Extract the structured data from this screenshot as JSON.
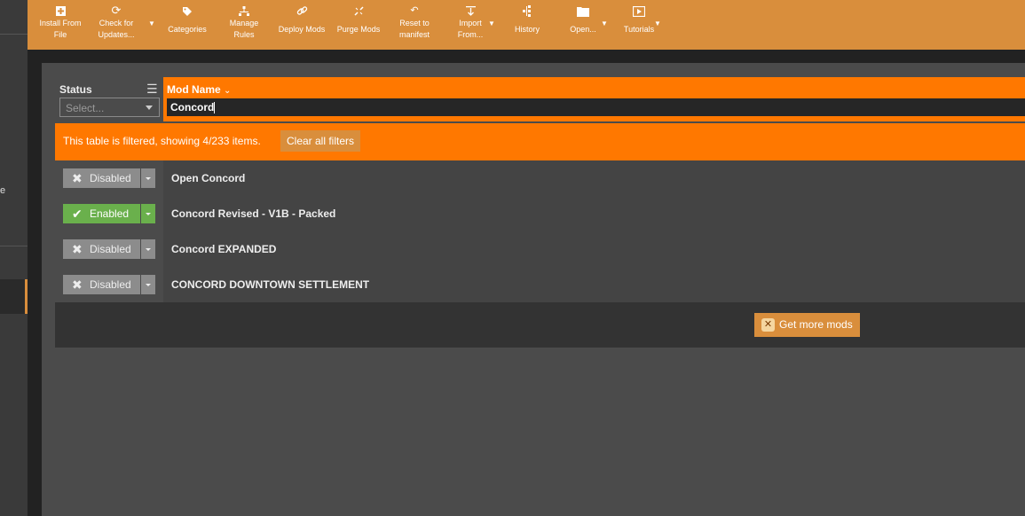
{
  "toolbar": {
    "install": [
      "Install From",
      "File"
    ],
    "check_updates": [
      "Check for",
      "Updates..."
    ],
    "categories": "Categories",
    "manage_rules": [
      "Manage",
      "Rules"
    ],
    "deploy": "Deploy Mods",
    "purge": "Purge Mods",
    "reset": [
      "Reset to",
      "manifest"
    ],
    "import": [
      "Import",
      "From..."
    ],
    "history": "History",
    "open": "Open...",
    "tutorials": "Tutorials"
  },
  "sidebar": {
    "partial_text": "e"
  },
  "table": {
    "status_header": "Status",
    "status_placeholder": "Select...",
    "name_header": "Mod Name",
    "name_sort_glyph": "⌄",
    "name_filter_value": "Concord"
  },
  "banner": {
    "text": "This table is filtered, showing 4/233 items.",
    "clear_label": "Clear all filters"
  },
  "mods": [
    {
      "status": "Disabled",
      "enabled": false,
      "name": "Open Concord"
    },
    {
      "status": "Enabled",
      "enabled": true,
      "name": "Concord Revised - V1B - Packed"
    },
    {
      "status": "Disabled",
      "enabled": false,
      "name": "Concord EXPANDED"
    },
    {
      "status": "Disabled",
      "enabled": false,
      "name": "CONCORD DOWNTOWN SETTLEMENT"
    }
  ],
  "footer": {
    "get_more_label": "Get more mods"
  },
  "colors": {
    "accent": "#d98e3c",
    "filter_orange": "#ff7800",
    "enabled_green": "#6ab04c",
    "disabled_grey": "#8c8c8c"
  },
  "icons": {
    "disabled_mark": "✖",
    "enabled_mark": "✔",
    "list_icon": "☰"
  }
}
